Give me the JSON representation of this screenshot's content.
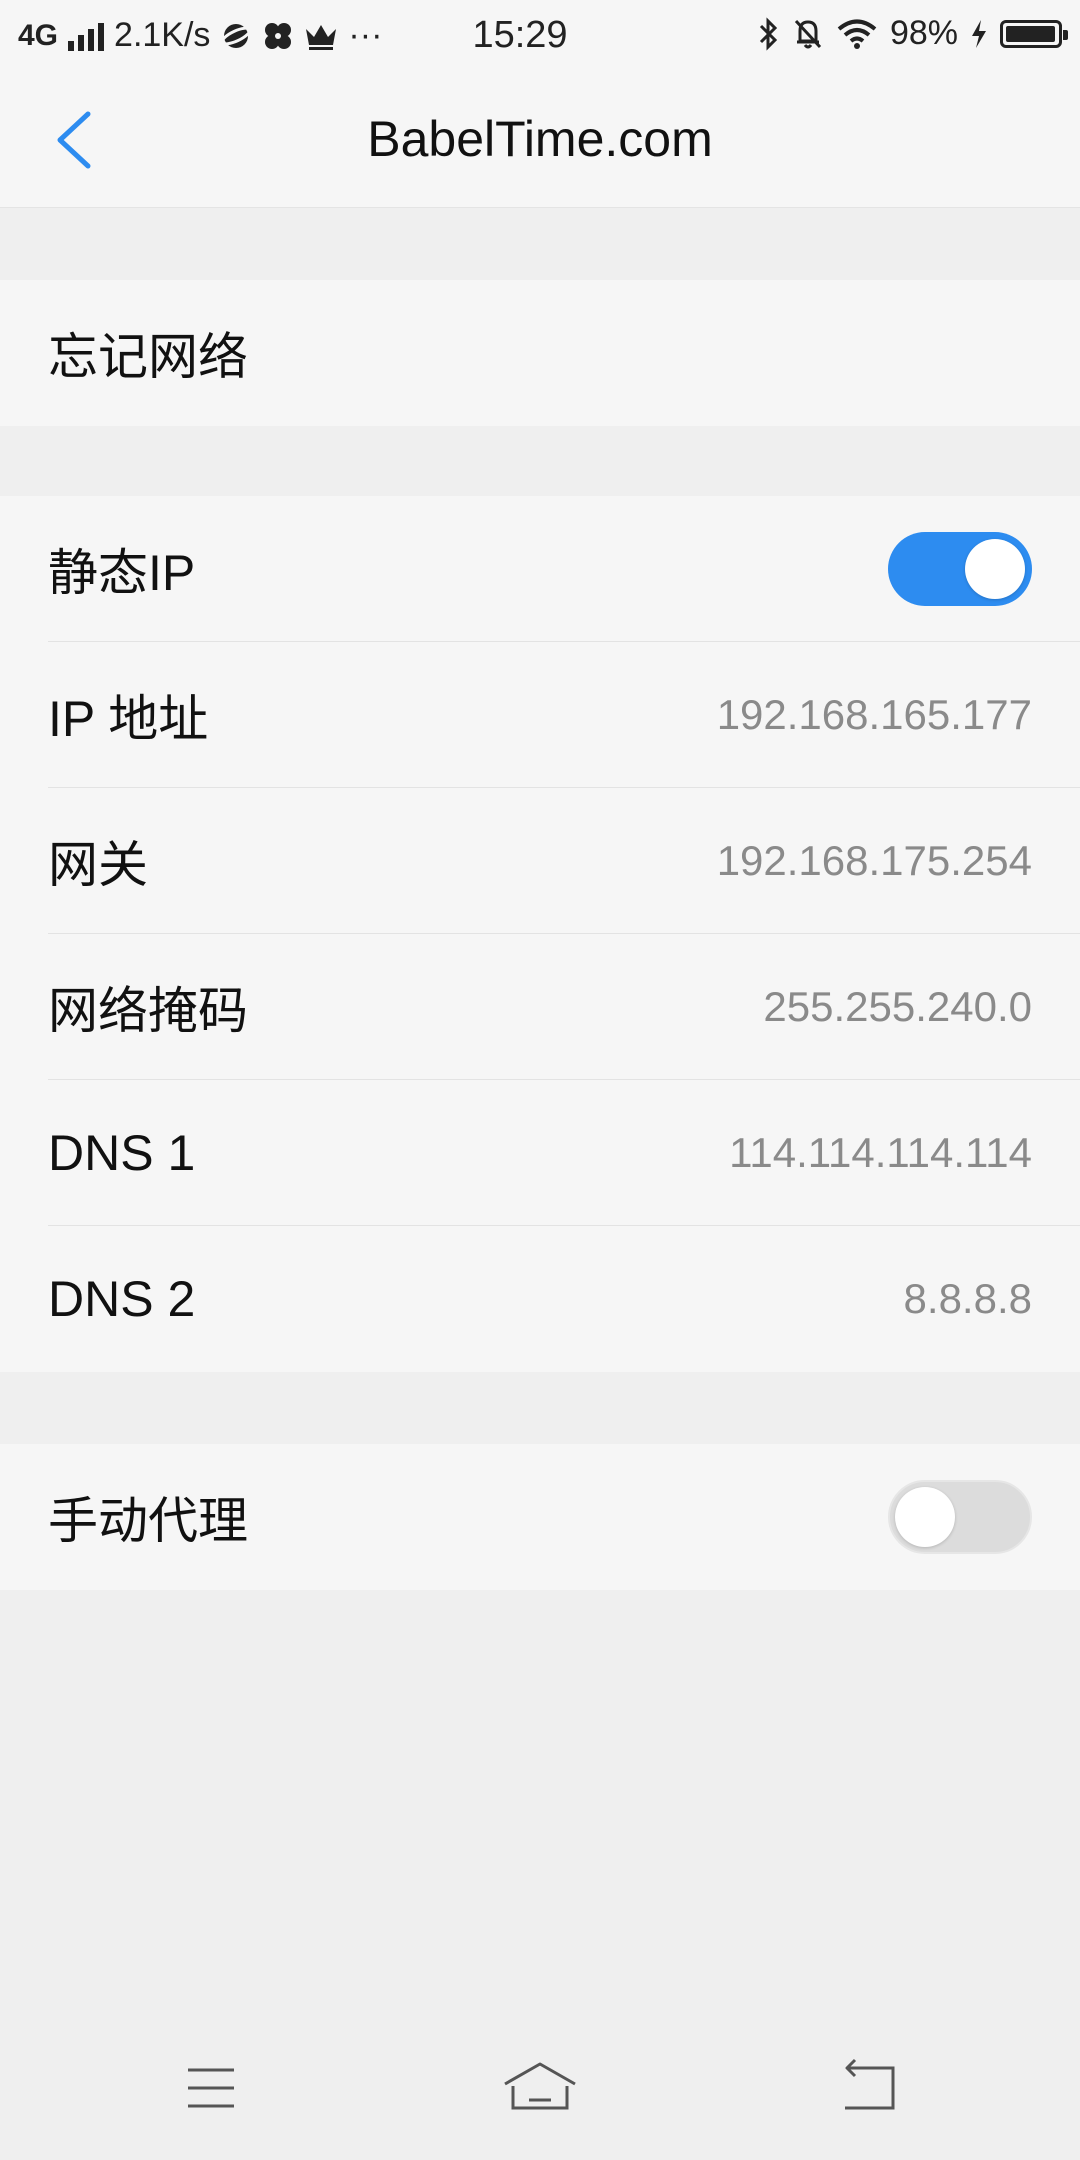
{
  "status_bar": {
    "network_type": "4G",
    "speed": "2.1K/s",
    "more": "···",
    "time": "15:29",
    "battery_percent": "98%",
    "battery_level": 0.98
  },
  "header": {
    "title": "BabelTime.com",
    "accent_color": "#2d8cf0"
  },
  "forget": {
    "label": "忘记网络"
  },
  "static_ip": {
    "label": "静态IP",
    "enabled": true,
    "rows": [
      {
        "label": "IP 地址",
        "value": "192.168.165.177"
      },
      {
        "label": "网关",
        "value": "192.168.175.254"
      },
      {
        "label": "网络掩码",
        "value": "255.255.240.0"
      },
      {
        "label": "DNS 1",
        "value": "114.114.114.114"
      },
      {
        "label": "DNS 2",
        "value": "8.8.8.8"
      }
    ]
  },
  "proxy": {
    "label": "手动代理",
    "enabled": false
  },
  "nav": {
    "icons": [
      "menu-icon",
      "home-icon",
      "back-icon"
    ]
  }
}
